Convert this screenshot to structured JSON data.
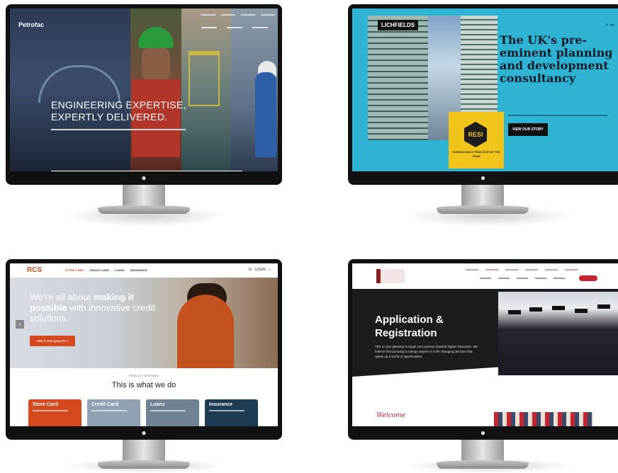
{
  "monitors": [
    {
      "site": "Petrofac",
      "logo": "Petrofac",
      "headline_1": "ENGINEERING EXPERTISE,",
      "headline_2": "EXPERTLY DELIVERED."
    },
    {
      "site": "Lichfields",
      "logo": "LICHFIELDS",
      "headline": "The UK's pre-eminent planning and development consultancy",
      "button": "VIEW OUR STORY",
      "badge_mark": "RESI",
      "badge_text": "CONSULTANCY PRACTICE OF THE YEAR"
    },
    {
      "site": "RCS",
      "logo": "RCS",
      "nav": [
        "STORE CARD",
        "CREDIT CARD",
        "LOANS",
        "INSURANCE"
      ],
      "login": "LOGIN",
      "headline_pre": "We're all about ",
      "headline_bold1": "making it possible",
      "headline_mid": " with innovative credit solutions.",
      "cta": "SEE IF YOU QUALIFY  >",
      "section_label": "PRODUCT OFFERING",
      "section_title": "This is what we do",
      "cards": [
        {
          "label": "Store Card",
          "color": "#d6491f"
        },
        {
          "label": "Credit Card",
          "color": "#8fa1b2"
        },
        {
          "label": "Loans",
          "color": "#6f8294"
        },
        {
          "label": "Insurance",
          "color": "#1f3c55"
        }
      ]
    },
    {
      "site": "Application & Registration",
      "headline_1": "Application &",
      "headline_2": "Registration",
      "body": "This is your gateway to begin your journey towards higher education. We believe that pursuing a college degree is a life-changing decision that opens up a world of opportunities.",
      "welcome": "Welcome"
    }
  ],
  "apple_logo": "",
  "colors": {
    "bezel": "#111111",
    "lichfields_bg": "#2fb3d3",
    "rcs_accent": "#d6491f",
    "app_red": "#c8242f"
  }
}
